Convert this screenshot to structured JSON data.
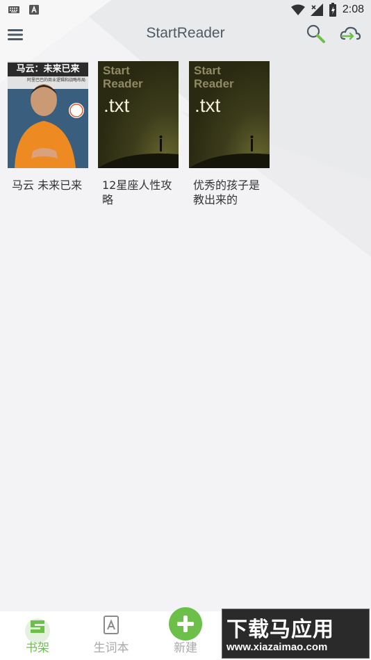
{
  "status_bar": {
    "time": "2:08"
  },
  "app_bar": {
    "title": "StartReader"
  },
  "books": [
    {
      "title": "马云 未来已来",
      "cover": {
        "type": "photo",
        "title": "马云：未来已来",
        "subtitle": "阿里巴巴的商业逻辑和战略布局"
      }
    },
    {
      "title": "12星座人性攻略",
      "cover": {
        "type": "txt",
        "brand": "Start Reader",
        "ext": ".txt"
      }
    },
    {
      "title": "优秀的孩子是教出来的",
      "cover": {
        "type": "txt",
        "brand": "Start Reader",
        "ext": ".txt"
      }
    }
  ],
  "bottom_nav": {
    "bookshelf": "书架",
    "vocab": "生词本",
    "new": "新建"
  },
  "watermark": {
    "line1": "下载马应用",
    "line2": "www.xiazaimao.com"
  },
  "colors": {
    "accent": "#6cc04a",
    "title": "#4c5a66",
    "inactive": "#a9a9a9"
  }
}
